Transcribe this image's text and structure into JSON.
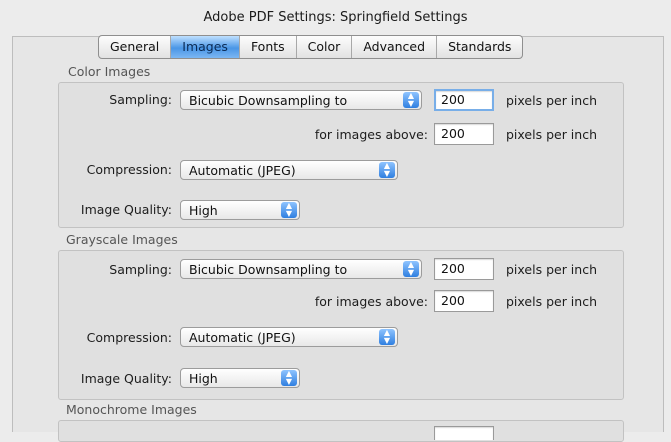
{
  "window": {
    "title": "Adobe PDF Settings: Springfield Settings"
  },
  "tabs": [
    "General",
    "Images",
    "Fonts",
    "Color",
    "Advanced",
    "Standards"
  ],
  "active_tab": "Images",
  "color_images": {
    "title": "Color Images",
    "sampling_label": "Sampling:",
    "sampling_value": "Bicubic Downsampling to",
    "resolution": "200",
    "resolution_unit": "pixels per inch",
    "above_label": "for images above:",
    "above_value": "200",
    "above_unit": "pixels per inch",
    "compression_label": "Compression:",
    "compression_value": "Automatic (JPEG)",
    "quality_label": "Image Quality:",
    "quality_value": "High"
  },
  "grayscale_images": {
    "title": "Grayscale Images",
    "sampling_label": "Sampling:",
    "sampling_value": "Bicubic Downsampling to",
    "resolution": "200",
    "resolution_unit": "pixels per inch",
    "above_label": "for images above:",
    "above_value": "200",
    "above_unit": "pixels per inch",
    "compression_label": "Compression:",
    "compression_value": "Automatic (JPEG)",
    "quality_label": "Image Quality:",
    "quality_value": "High"
  },
  "monochrome_images": {
    "title": "Monochrome Images"
  },
  "colors": {
    "accent": "#4a96e6",
    "panel": "#e0e0e0"
  }
}
